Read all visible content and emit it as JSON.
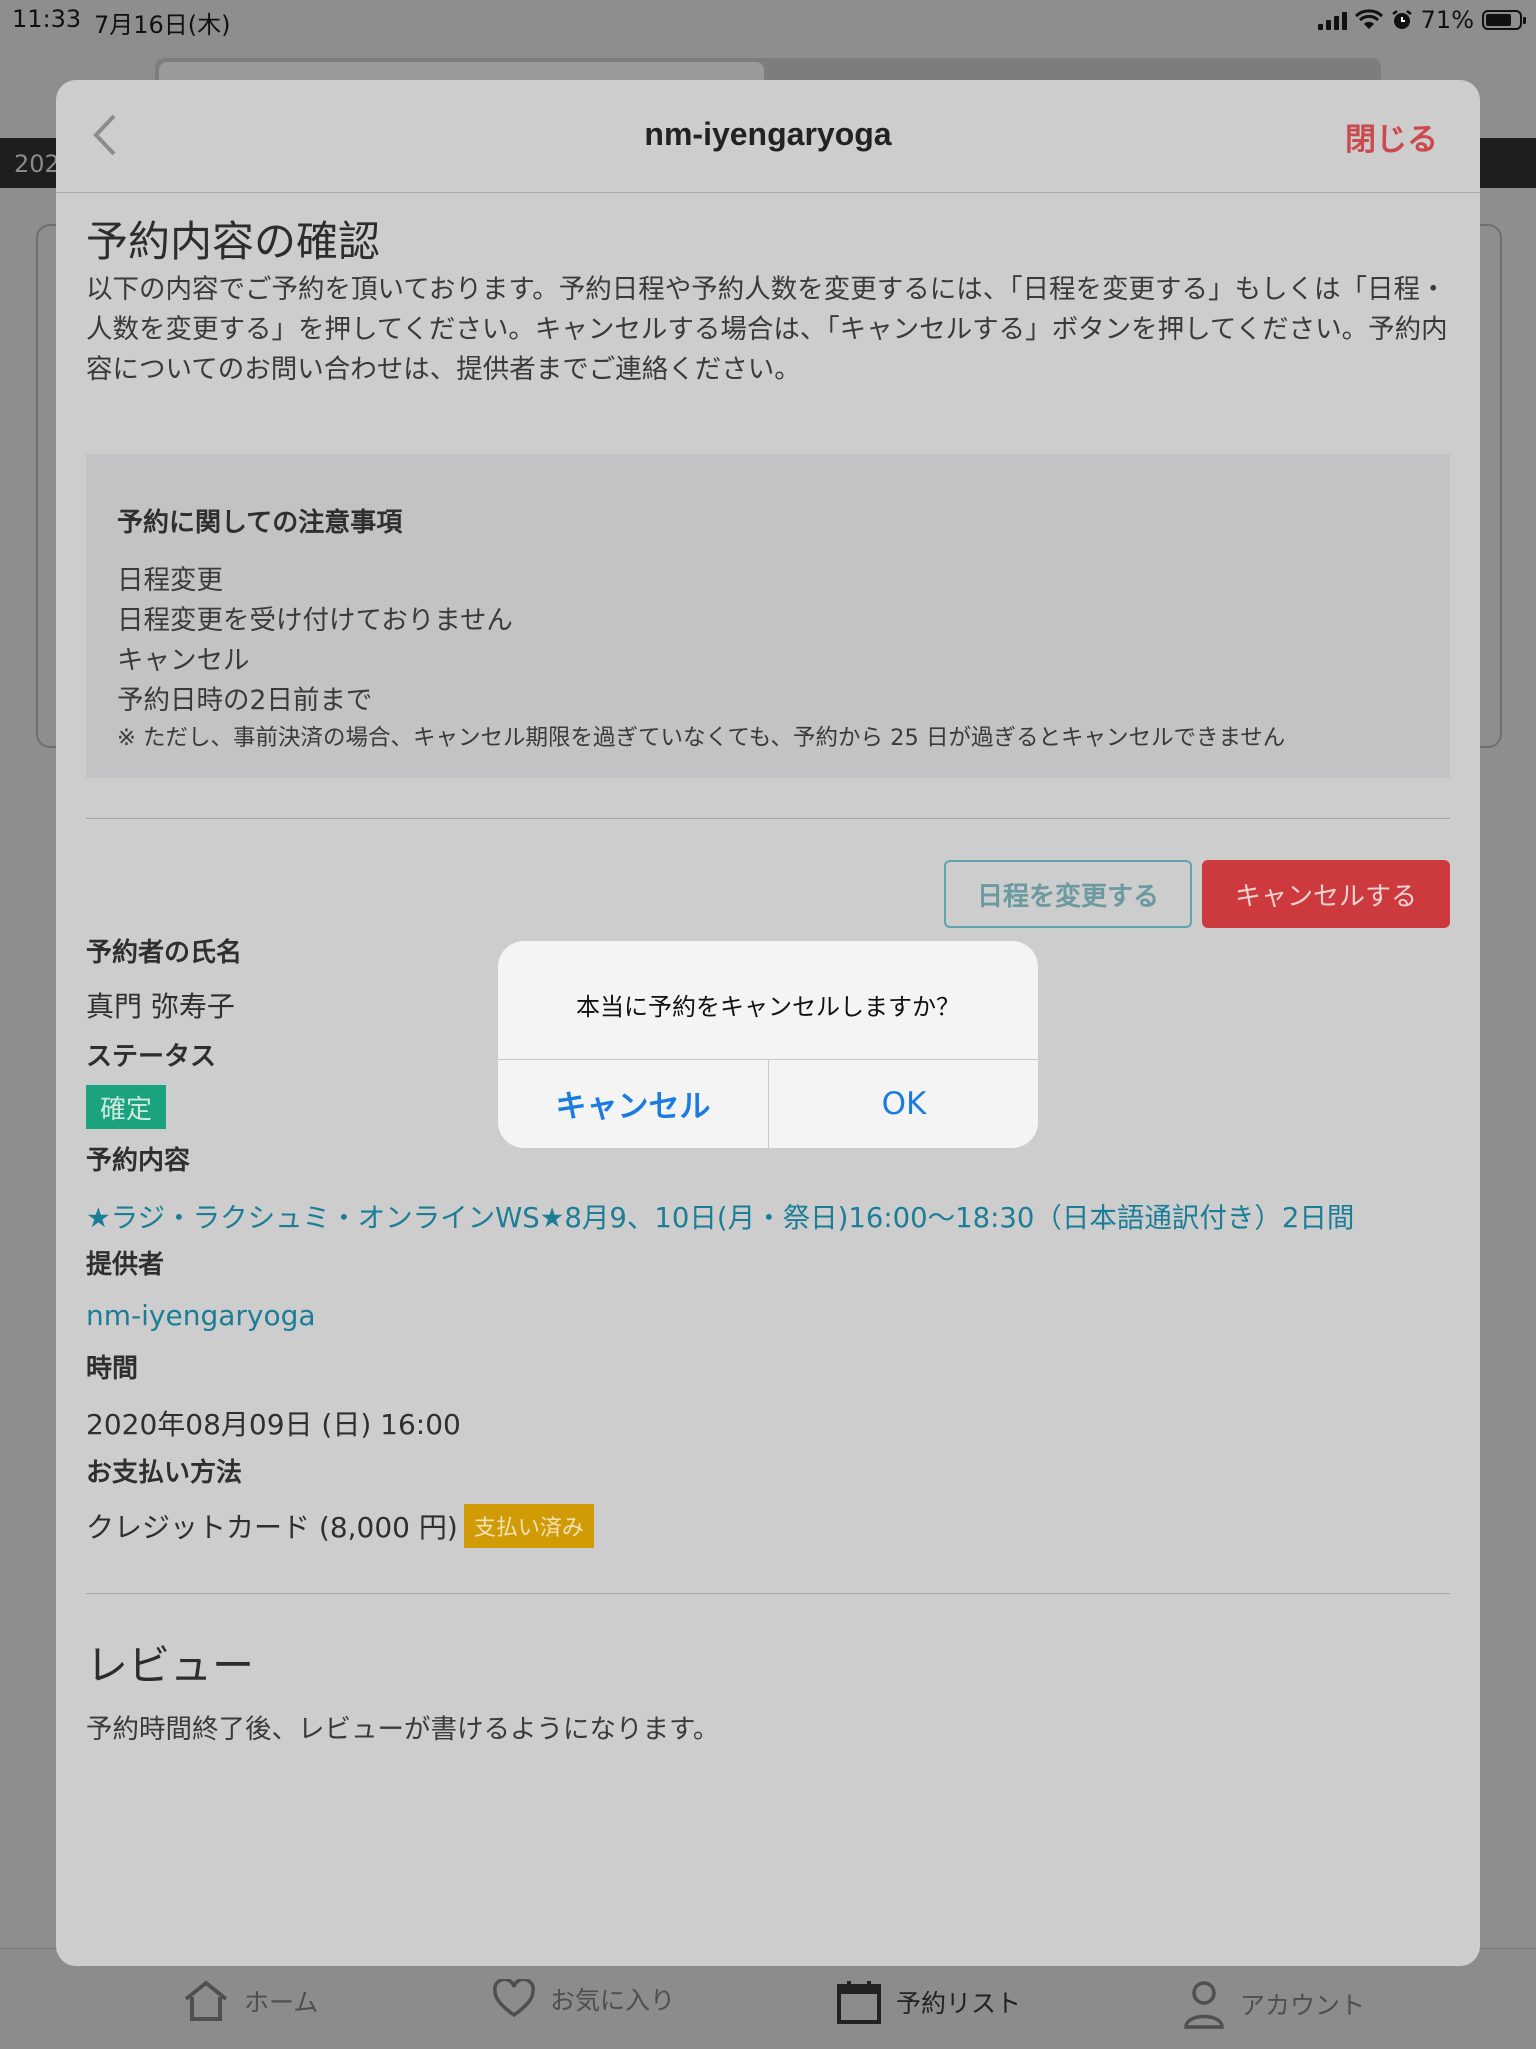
{
  "status_bar": {
    "time": "11:33",
    "date": "7月16日(木)",
    "battery": "71%"
  },
  "background": {
    "date_strip_text": "202",
    "tabs": [
      {
        "label": "ホーム",
        "icon": "home-icon"
      },
      {
        "label": "お気に入り",
        "icon": "heart-icon"
      },
      {
        "label": "予約リスト",
        "icon": "calendar-icon"
      },
      {
        "label": "アカウント",
        "icon": "person-icon"
      }
    ]
  },
  "nav": {
    "title": "nm-iyengaryoga",
    "close_label": "閉じる"
  },
  "page": {
    "heading": "予約内容の確認",
    "intro": "以下の内容でご予約を頂いております。予約日程や予約人数を変更するには、「日程を変更する」もしくは「日程・人数を変更する」を押してください。キャンセルする場合は、「キャンセルする」ボタンを押してください。予約内容についてのお問い合わせは、提供者までご連絡ください。"
  },
  "notice": {
    "title": "予約に関しての注意事項",
    "lines": [
      "日程変更",
      "日程変更を受け付けておりません",
      "キャンセル",
      "予約日時の2日前まで"
    ],
    "footnote": "※ ただし、事前決済の場合、キャンセル期限を過ぎていなくても、予約から 25 日が過ぎるとキャンセルできません"
  },
  "actions": {
    "reschedule_label": "日程を変更する",
    "cancel_label": "キャンセルする"
  },
  "details": {
    "name_label": "予約者の氏名",
    "name_value": "真門 弥寿子",
    "status_label": "ステータス",
    "status_value": "確定",
    "content_label": "予約内容",
    "content_value": "★ラジ・ラクシュミ・オンラインWS★8月9、10日(月・祭日)16:00〜18:30（日本語通訳付き）2日間",
    "provider_label": "提供者",
    "provider_value": "nm-iyengaryoga",
    "time_label": "時間",
    "time_value": "2020年08月09日 (日) 16:00",
    "payment_label": "お支払い方法",
    "payment_value": "クレジットカード (8,000 円)",
    "payment_badge": "支払い済み"
  },
  "review": {
    "heading": "レビュー",
    "note": "予約時間終了後、レビューが書けるようになります。"
  },
  "alert": {
    "message": "本当に予約をキャンセルしますか？",
    "cancel_label": "キャンセル",
    "ok_label": "OK"
  },
  "colors": {
    "close_red": "#c94a4f",
    "cancel_button": "#cd3a3d",
    "link_teal": "#1b7e96",
    "status_green": "#1aa37e",
    "paid_yellow": "#d19b06",
    "alert_blue": "#1a7ce0"
  }
}
